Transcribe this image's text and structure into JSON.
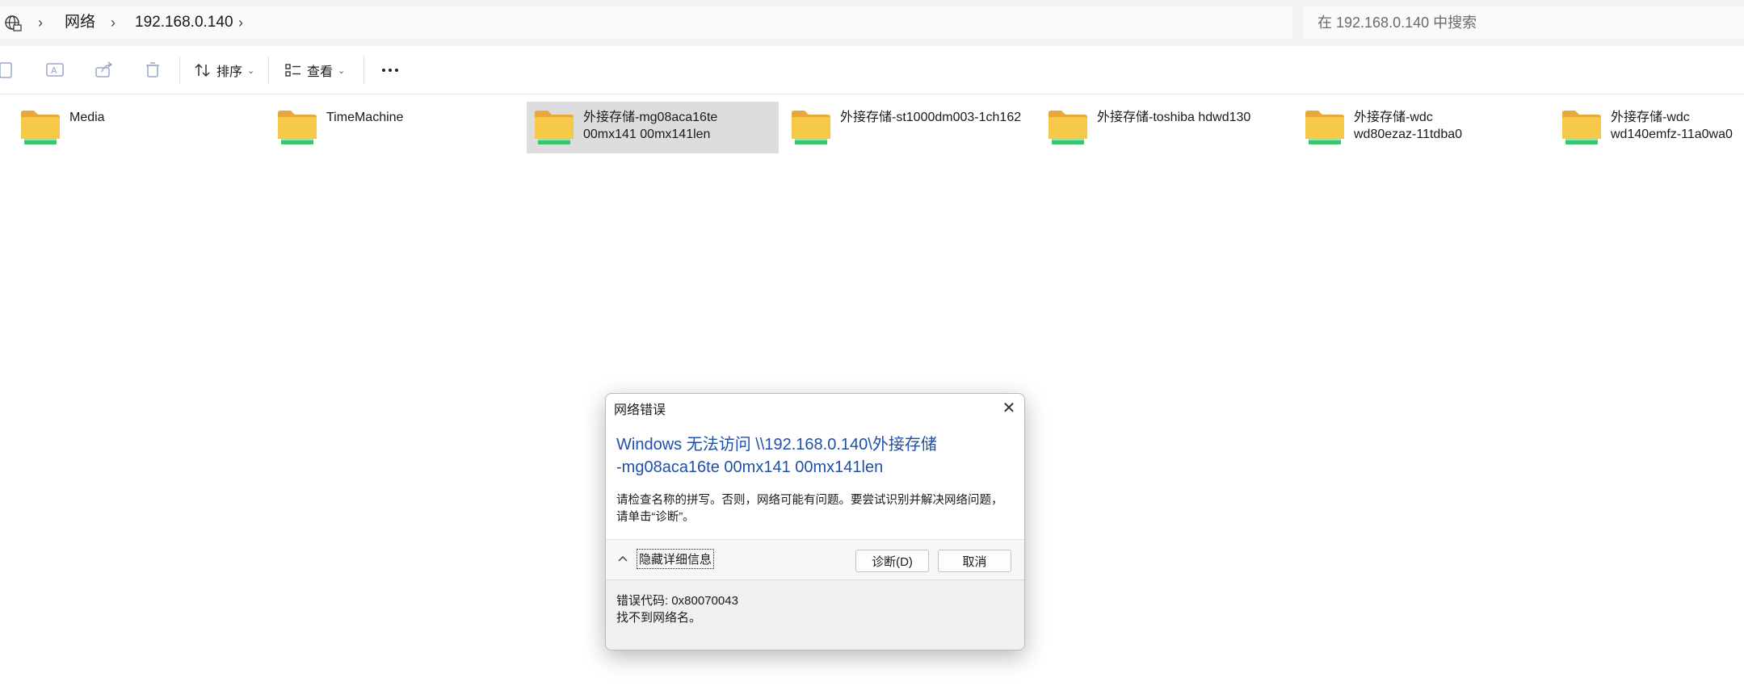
{
  "address_bar": {
    "breadcrumb": [
      "网络",
      "192.168.0.140"
    ],
    "search_placeholder": "在 192.168.0.140 中搜索"
  },
  "toolbar": {
    "sort_label": "排序",
    "view_label": "查看"
  },
  "folders": [
    {
      "name": "Media",
      "selected": false
    },
    {
      "name": "TimeMachine",
      "selected": false
    },
    {
      "name": "外接存储-mg08aca16te\n00mx141 00mx141len",
      "selected": true
    },
    {
      "name": "外接存储-st1000dm003-1ch162",
      "selected": false
    },
    {
      "name": "外接存储-toshiba hdwd130",
      "selected": false
    },
    {
      "name": "外接存储-wdc\nwd80ezaz-11tdba0",
      "selected": false
    },
    {
      "name": "外接存储-wdc\nwd140emfz-11a0wa0",
      "selected": false
    }
  ],
  "dialog": {
    "title": "网络错误",
    "heading": "Windows 无法访问 \\\\192.168.0.140\\外接存储\n-mg08aca16te 00mx141 00mx141len",
    "message": "请检查名称的拼写。否则，网络可能有问题。要尝试识别并解决网络问题，请单击“诊断”。",
    "toggle_label": "隐藏详细信息",
    "diagnose_label": "诊断(D)",
    "cancel_label": "取消",
    "error_code": "错误代码: 0x80070043",
    "error_desc": "找不到网络名。"
  },
  "colors": {
    "heading": "#1f4fa8",
    "selection": "#dddddd",
    "folder_yellow": "#f7c948",
    "folder_green": "#3cc46a"
  }
}
